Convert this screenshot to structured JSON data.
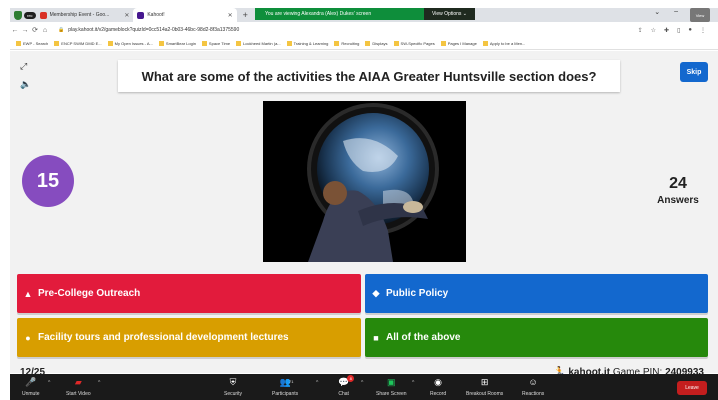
{
  "browser": {
    "tabs": [
      {
        "label": "Membership Event - Goo..."
      },
      {
        "label": "Kahoot!"
      }
    ],
    "rec_label": "rec",
    "banner_text": "You are viewing Alexandra (Alex) Dukes' screen",
    "view_options_label": "View Options",
    "view_badge": "View",
    "url": "play.kahoot.it/v2/gameblock?quizId=0cc514a2-0b03-46bc-98d2-8f3a1375590",
    "bookmarks": [
      "EWP - Search",
      "ENCP SWIM DMD E...",
      "My Open Issues - A...",
      "SmartBear Login",
      "Space Time",
      "Lockheed Martin (a...",
      "Training & Learning",
      "Recruiting",
      "Displays",
      "SW-Specific Pages",
      "Pages I Manage",
      "Apply to be a Men..."
    ]
  },
  "kahoot": {
    "question": "What are some of the activities the AIAA Greater Huntsville section does?",
    "skip_label": "Skip",
    "timer": "15",
    "answers_count": "24",
    "answers_label": "Answers",
    "answers": [
      {
        "shape": "triangle",
        "label": "Pre-College Outreach",
        "color": "#e21b3c"
      },
      {
        "shape": "diamond",
        "label": "Public Policy",
        "color": "#1368ce"
      },
      {
        "shape": "circle",
        "label": "Facility tours and professional development lectures",
        "color": "#d89e00"
      },
      {
        "shape": "square",
        "label": "All of the above",
        "color": "#26890c"
      }
    ],
    "question_counter": "12/25",
    "site_label": "kahoot.it",
    "pin_label": "Game PIN:",
    "pin_value": "2409933"
  },
  "zoom": {
    "unmute": "Unmute",
    "start_video": "Start Video",
    "security": "Security",
    "participants": "Participants",
    "participants_count": "71",
    "chat": "Chat",
    "chat_badge": "8",
    "share_screen": "Share Screen",
    "record": "Record",
    "breakout_rooms": "Breakout Rooms",
    "reactions": "Reactions",
    "leave": "Leave"
  }
}
